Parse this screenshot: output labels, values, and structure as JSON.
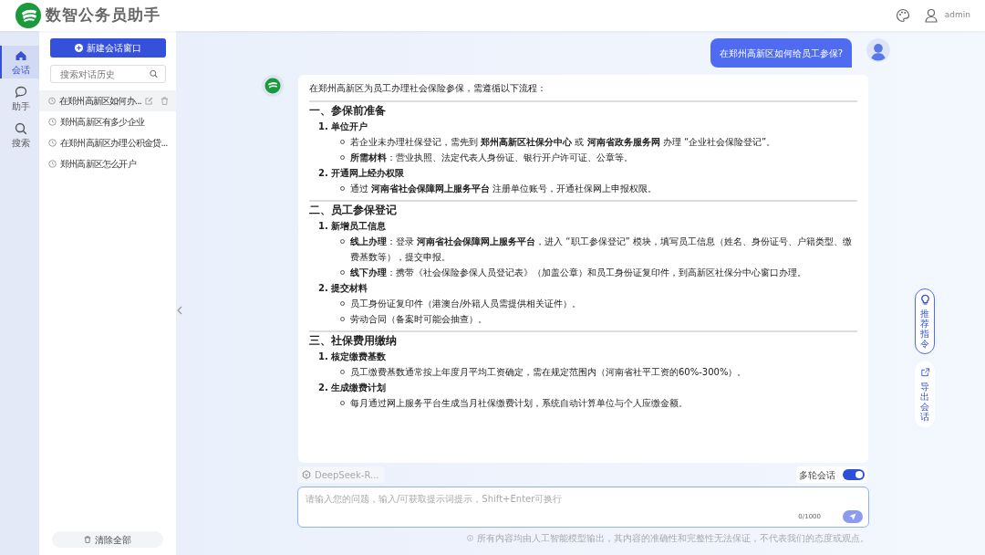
{
  "header": {
    "title": "数智公务员助手",
    "user": "admin"
  },
  "nav": [
    {
      "label": "会话",
      "selected": true
    },
    {
      "label": "助手",
      "selected": false
    },
    {
      "label": "搜索",
      "selected": false
    }
  ],
  "sidebar": {
    "new_button": "新建会话窗口",
    "search": {
      "placeholder": "搜索对话历史"
    },
    "history": [
      {
        "title": "在郑州高新区如何办...",
        "selected": true
      },
      {
        "title": "郑州高新区有多少企业",
        "selected": false
      },
      {
        "title": "在郑州高新区办理公积金贷...",
        "selected": false
      },
      {
        "title": "郑州高新区怎么开户",
        "selected": false
      }
    ],
    "clear_button": "清除全部"
  },
  "chat": {
    "user_message": "在郑州高新区如何给员工参保?",
    "answer": {
      "intro": "在郑州高新区为员工办理社会保险参保，需遵循以下流程：",
      "sections": [
        {
          "heading": "一、参保前准备",
          "items": [
            {
              "title": "1. 单位开户",
              "bullets": [
                "若企业未办理社保登记，需先到 **郑州高新区社保分中心** 或 **河南省政务服务网** 办理 “企业社会保险登记”。",
                "**所需材料**：营业执照、法定代表人身份证、银行开户许可证、公章等。"
              ]
            },
            {
              "title": "2. 开通网上经办权限",
              "bullets": [
                "通过 **河南省社会保障网上服务平台** 注册单位账号，开通社保网上申报权限。"
              ]
            }
          ]
        },
        {
          "heading": "二、员工参保登记",
          "items": [
            {
              "title": "1. 新增员工信息",
              "bullets": [
                "**线上办理**：登录 **河南省社会保障网上服务平台**，进入 “职工参保登记” 模块，填写员工信息（姓名、身份证号、户籍类型、缴费基数等），提交申报。",
                "**线下办理**：携带《社会保险参保人员登记表》（加盖公章）和员工身份证复印件，到高新区社保分中心窗口办理。"
              ]
            },
            {
              "title": "2. 提交材料",
              "bullets": [
                "员工身份证复印件（港澳台/外籍人员需提供相关证件）。",
                "劳动合同（备案时可能会抽查）。"
              ]
            }
          ]
        },
        {
          "heading": "三、社保费用缴纳",
          "items": [
            {
              "title": "1. 核定缴费基数",
              "bullets": [
                "员工缴费基数通常按上年度月平均工资确定，需在规定范围内（河南省社平工资的60%-300%）。"
              ]
            },
            {
              "title": "2. 生成缴费计划",
              "bullets": [
                "每月通过网上服务平台生成当月社保缴费计划，系统自动计算单位与个人应缴金额。"
              ]
            }
          ]
        }
      ]
    }
  },
  "composer": {
    "model": "DeepSeek-R...",
    "multi_turn": {
      "label": "多轮会话",
      "on": true
    },
    "input": {
      "placeholder": "请输入您的问题，输入/可获取提示词提示，Shift+Enter可换行"
    },
    "counter": "0/1000",
    "disclaimer": "所有内容均由人工智能模型输出，其内容的准确性和完整性无法保证，不代表我们的态度或观点。"
  },
  "side_actions": [
    {
      "label": "推荐指令",
      "selected": true
    },
    {
      "label": "导出会话",
      "selected": false
    }
  ]
}
